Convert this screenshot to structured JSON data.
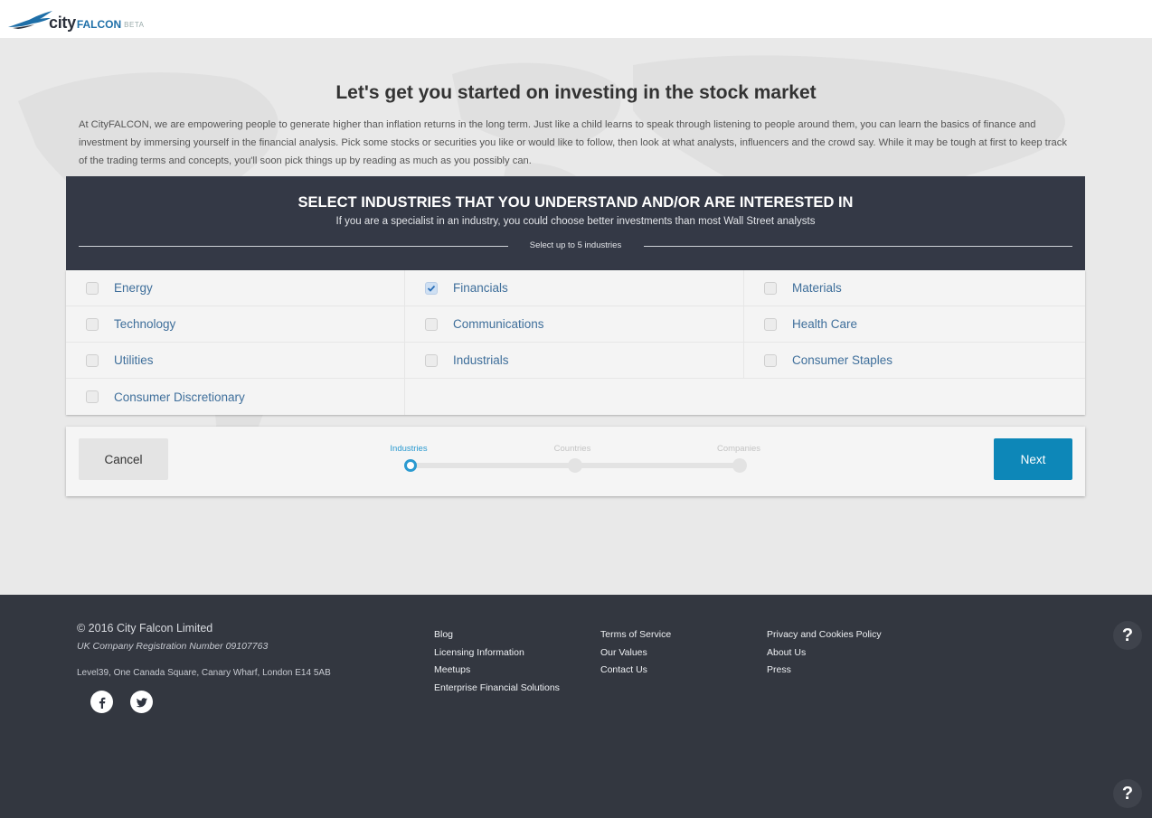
{
  "header": {
    "logo_city": "city",
    "logo_falcon": "FALCON",
    "logo_beta": "BETA",
    "logo_icon": "falcon-bird-icon"
  },
  "intro": {
    "headline": "Let's get you started on investing in the stock market",
    "paragraph": "At CityFALCON, we are empowering people to generate higher than inflation returns in the long term. Just like a child learns to speak through listening to people around them, you can learn the basics of finance and investment by immersing yourself in the financial analysis. Pick some stocks or securities you like or would like to follow, then look at what analysts, influencers and the crowd say. While it may be tough at first to keep track of the trading terms and concepts, you'll soon pick things up by reading as much as you possibly can."
  },
  "selector": {
    "title": "SELECT INDUSTRIES THAT YOU UNDERSTAND AND/OR ARE INTERESTED IN",
    "subtitle": "If you are a specialist in an industry, you could choose better investments than most Wall Street analysts",
    "limit_note": "Select up to 5 industries",
    "industries": [
      {
        "label": "Energy",
        "checked": false
      },
      {
        "label": "Financials",
        "checked": true
      },
      {
        "label": "Materials",
        "checked": false
      },
      {
        "label": "Technology",
        "checked": false
      },
      {
        "label": "Communications",
        "checked": false
      },
      {
        "label": "Health Care",
        "checked": false
      },
      {
        "label": "Utilities",
        "checked": false
      },
      {
        "label": "Industrials",
        "checked": false
      },
      {
        "label": "Consumer Staples",
        "checked": false
      },
      {
        "label": "Consumer Discretionary",
        "checked": false
      }
    ]
  },
  "wizard": {
    "cancel_label": "Cancel",
    "next_label": "Next",
    "steps": [
      {
        "label": "Industries",
        "active": true
      },
      {
        "label": "Countries",
        "active": false
      },
      {
        "label": "Companies",
        "active": false
      }
    ]
  },
  "footer": {
    "copyright": "© 2016 City Falcon Limited",
    "registration": "UK Company Registration Number 09107763",
    "address": "Level39, One Canada Square, Canary Wharf, London E14 5AB",
    "social": [
      "facebook-icon",
      "twitter-icon"
    ],
    "links_col1": [
      "Blog",
      "Licensing Information",
      "Meetups",
      "Enterprise Financial Solutions"
    ],
    "links_col2": [
      "Terms of Service",
      "Our Values",
      "Contact Us"
    ],
    "links_col3": [
      "Privacy and Cookies Policy",
      "About Us",
      "Press"
    ],
    "help_label": "?"
  },
  "colors": {
    "header_band": "#343946",
    "footer_bg": "#333740",
    "accent": "#0d87b8",
    "link_text": "#3f6f9b"
  }
}
